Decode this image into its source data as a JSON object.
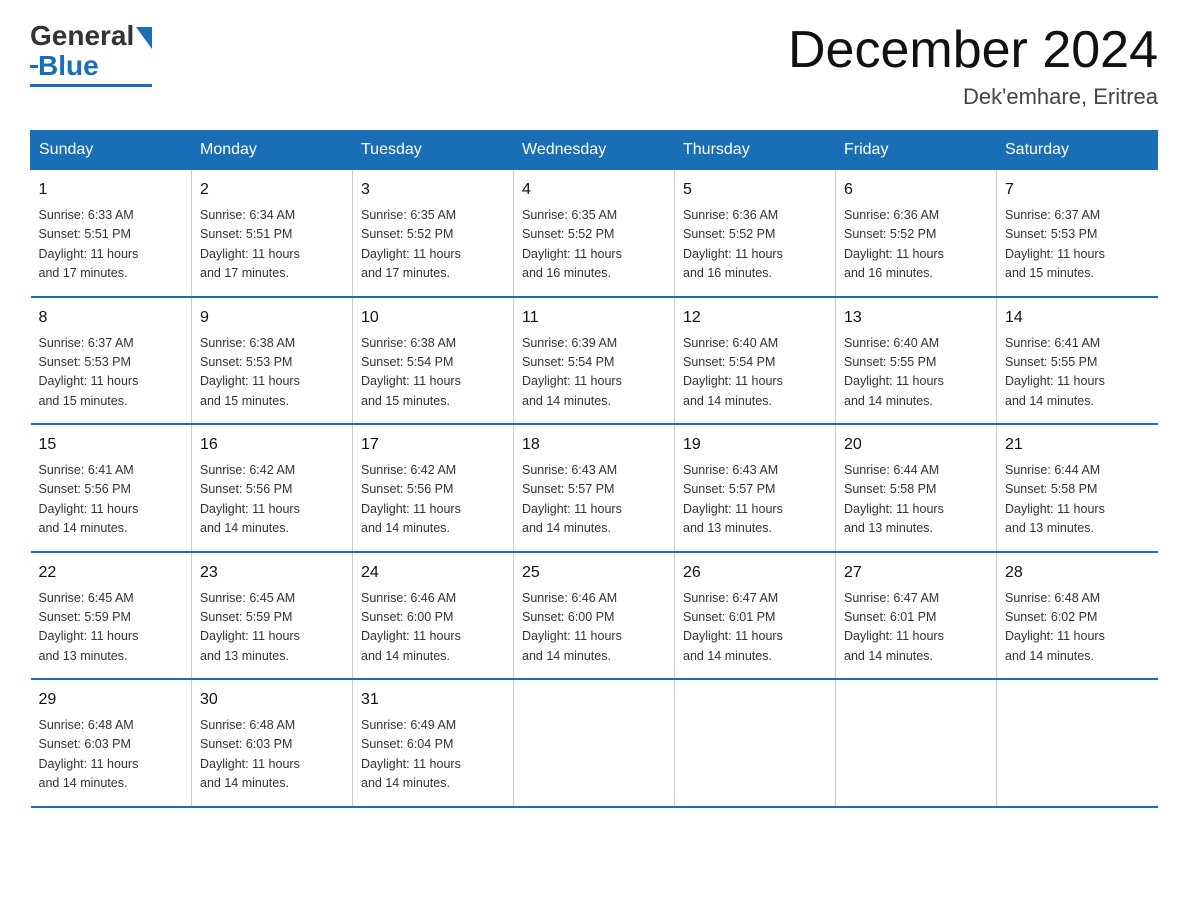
{
  "logo": {
    "general": "General",
    "blue": "Blue"
  },
  "title": "December 2024",
  "location": "Dek'emhare, Eritrea",
  "weekdays": [
    "Sunday",
    "Monday",
    "Tuesday",
    "Wednesday",
    "Thursday",
    "Friday",
    "Saturday"
  ],
  "weeks": [
    [
      {
        "day": "1",
        "info": "Sunrise: 6:33 AM\nSunset: 5:51 PM\nDaylight: 11 hours\nand 17 minutes."
      },
      {
        "day": "2",
        "info": "Sunrise: 6:34 AM\nSunset: 5:51 PM\nDaylight: 11 hours\nand 17 minutes."
      },
      {
        "day": "3",
        "info": "Sunrise: 6:35 AM\nSunset: 5:52 PM\nDaylight: 11 hours\nand 17 minutes."
      },
      {
        "day": "4",
        "info": "Sunrise: 6:35 AM\nSunset: 5:52 PM\nDaylight: 11 hours\nand 16 minutes."
      },
      {
        "day": "5",
        "info": "Sunrise: 6:36 AM\nSunset: 5:52 PM\nDaylight: 11 hours\nand 16 minutes."
      },
      {
        "day": "6",
        "info": "Sunrise: 6:36 AM\nSunset: 5:52 PM\nDaylight: 11 hours\nand 16 minutes."
      },
      {
        "day": "7",
        "info": "Sunrise: 6:37 AM\nSunset: 5:53 PM\nDaylight: 11 hours\nand 15 minutes."
      }
    ],
    [
      {
        "day": "8",
        "info": "Sunrise: 6:37 AM\nSunset: 5:53 PM\nDaylight: 11 hours\nand 15 minutes."
      },
      {
        "day": "9",
        "info": "Sunrise: 6:38 AM\nSunset: 5:53 PM\nDaylight: 11 hours\nand 15 minutes."
      },
      {
        "day": "10",
        "info": "Sunrise: 6:38 AM\nSunset: 5:54 PM\nDaylight: 11 hours\nand 15 minutes."
      },
      {
        "day": "11",
        "info": "Sunrise: 6:39 AM\nSunset: 5:54 PM\nDaylight: 11 hours\nand 14 minutes."
      },
      {
        "day": "12",
        "info": "Sunrise: 6:40 AM\nSunset: 5:54 PM\nDaylight: 11 hours\nand 14 minutes."
      },
      {
        "day": "13",
        "info": "Sunrise: 6:40 AM\nSunset: 5:55 PM\nDaylight: 11 hours\nand 14 minutes."
      },
      {
        "day": "14",
        "info": "Sunrise: 6:41 AM\nSunset: 5:55 PM\nDaylight: 11 hours\nand 14 minutes."
      }
    ],
    [
      {
        "day": "15",
        "info": "Sunrise: 6:41 AM\nSunset: 5:56 PM\nDaylight: 11 hours\nand 14 minutes."
      },
      {
        "day": "16",
        "info": "Sunrise: 6:42 AM\nSunset: 5:56 PM\nDaylight: 11 hours\nand 14 minutes."
      },
      {
        "day": "17",
        "info": "Sunrise: 6:42 AM\nSunset: 5:56 PM\nDaylight: 11 hours\nand 14 minutes."
      },
      {
        "day": "18",
        "info": "Sunrise: 6:43 AM\nSunset: 5:57 PM\nDaylight: 11 hours\nand 14 minutes."
      },
      {
        "day": "19",
        "info": "Sunrise: 6:43 AM\nSunset: 5:57 PM\nDaylight: 11 hours\nand 13 minutes."
      },
      {
        "day": "20",
        "info": "Sunrise: 6:44 AM\nSunset: 5:58 PM\nDaylight: 11 hours\nand 13 minutes."
      },
      {
        "day": "21",
        "info": "Sunrise: 6:44 AM\nSunset: 5:58 PM\nDaylight: 11 hours\nand 13 minutes."
      }
    ],
    [
      {
        "day": "22",
        "info": "Sunrise: 6:45 AM\nSunset: 5:59 PM\nDaylight: 11 hours\nand 13 minutes."
      },
      {
        "day": "23",
        "info": "Sunrise: 6:45 AM\nSunset: 5:59 PM\nDaylight: 11 hours\nand 13 minutes."
      },
      {
        "day": "24",
        "info": "Sunrise: 6:46 AM\nSunset: 6:00 PM\nDaylight: 11 hours\nand 14 minutes."
      },
      {
        "day": "25",
        "info": "Sunrise: 6:46 AM\nSunset: 6:00 PM\nDaylight: 11 hours\nand 14 minutes."
      },
      {
        "day": "26",
        "info": "Sunrise: 6:47 AM\nSunset: 6:01 PM\nDaylight: 11 hours\nand 14 minutes."
      },
      {
        "day": "27",
        "info": "Sunrise: 6:47 AM\nSunset: 6:01 PM\nDaylight: 11 hours\nand 14 minutes."
      },
      {
        "day": "28",
        "info": "Sunrise: 6:48 AM\nSunset: 6:02 PM\nDaylight: 11 hours\nand 14 minutes."
      }
    ],
    [
      {
        "day": "29",
        "info": "Sunrise: 6:48 AM\nSunset: 6:03 PM\nDaylight: 11 hours\nand 14 minutes."
      },
      {
        "day": "30",
        "info": "Sunrise: 6:48 AM\nSunset: 6:03 PM\nDaylight: 11 hours\nand 14 minutes."
      },
      {
        "day": "31",
        "info": "Sunrise: 6:49 AM\nSunset: 6:04 PM\nDaylight: 11 hours\nand 14 minutes."
      },
      {
        "day": "",
        "info": ""
      },
      {
        "day": "",
        "info": ""
      },
      {
        "day": "",
        "info": ""
      },
      {
        "day": "",
        "info": ""
      }
    ]
  ]
}
